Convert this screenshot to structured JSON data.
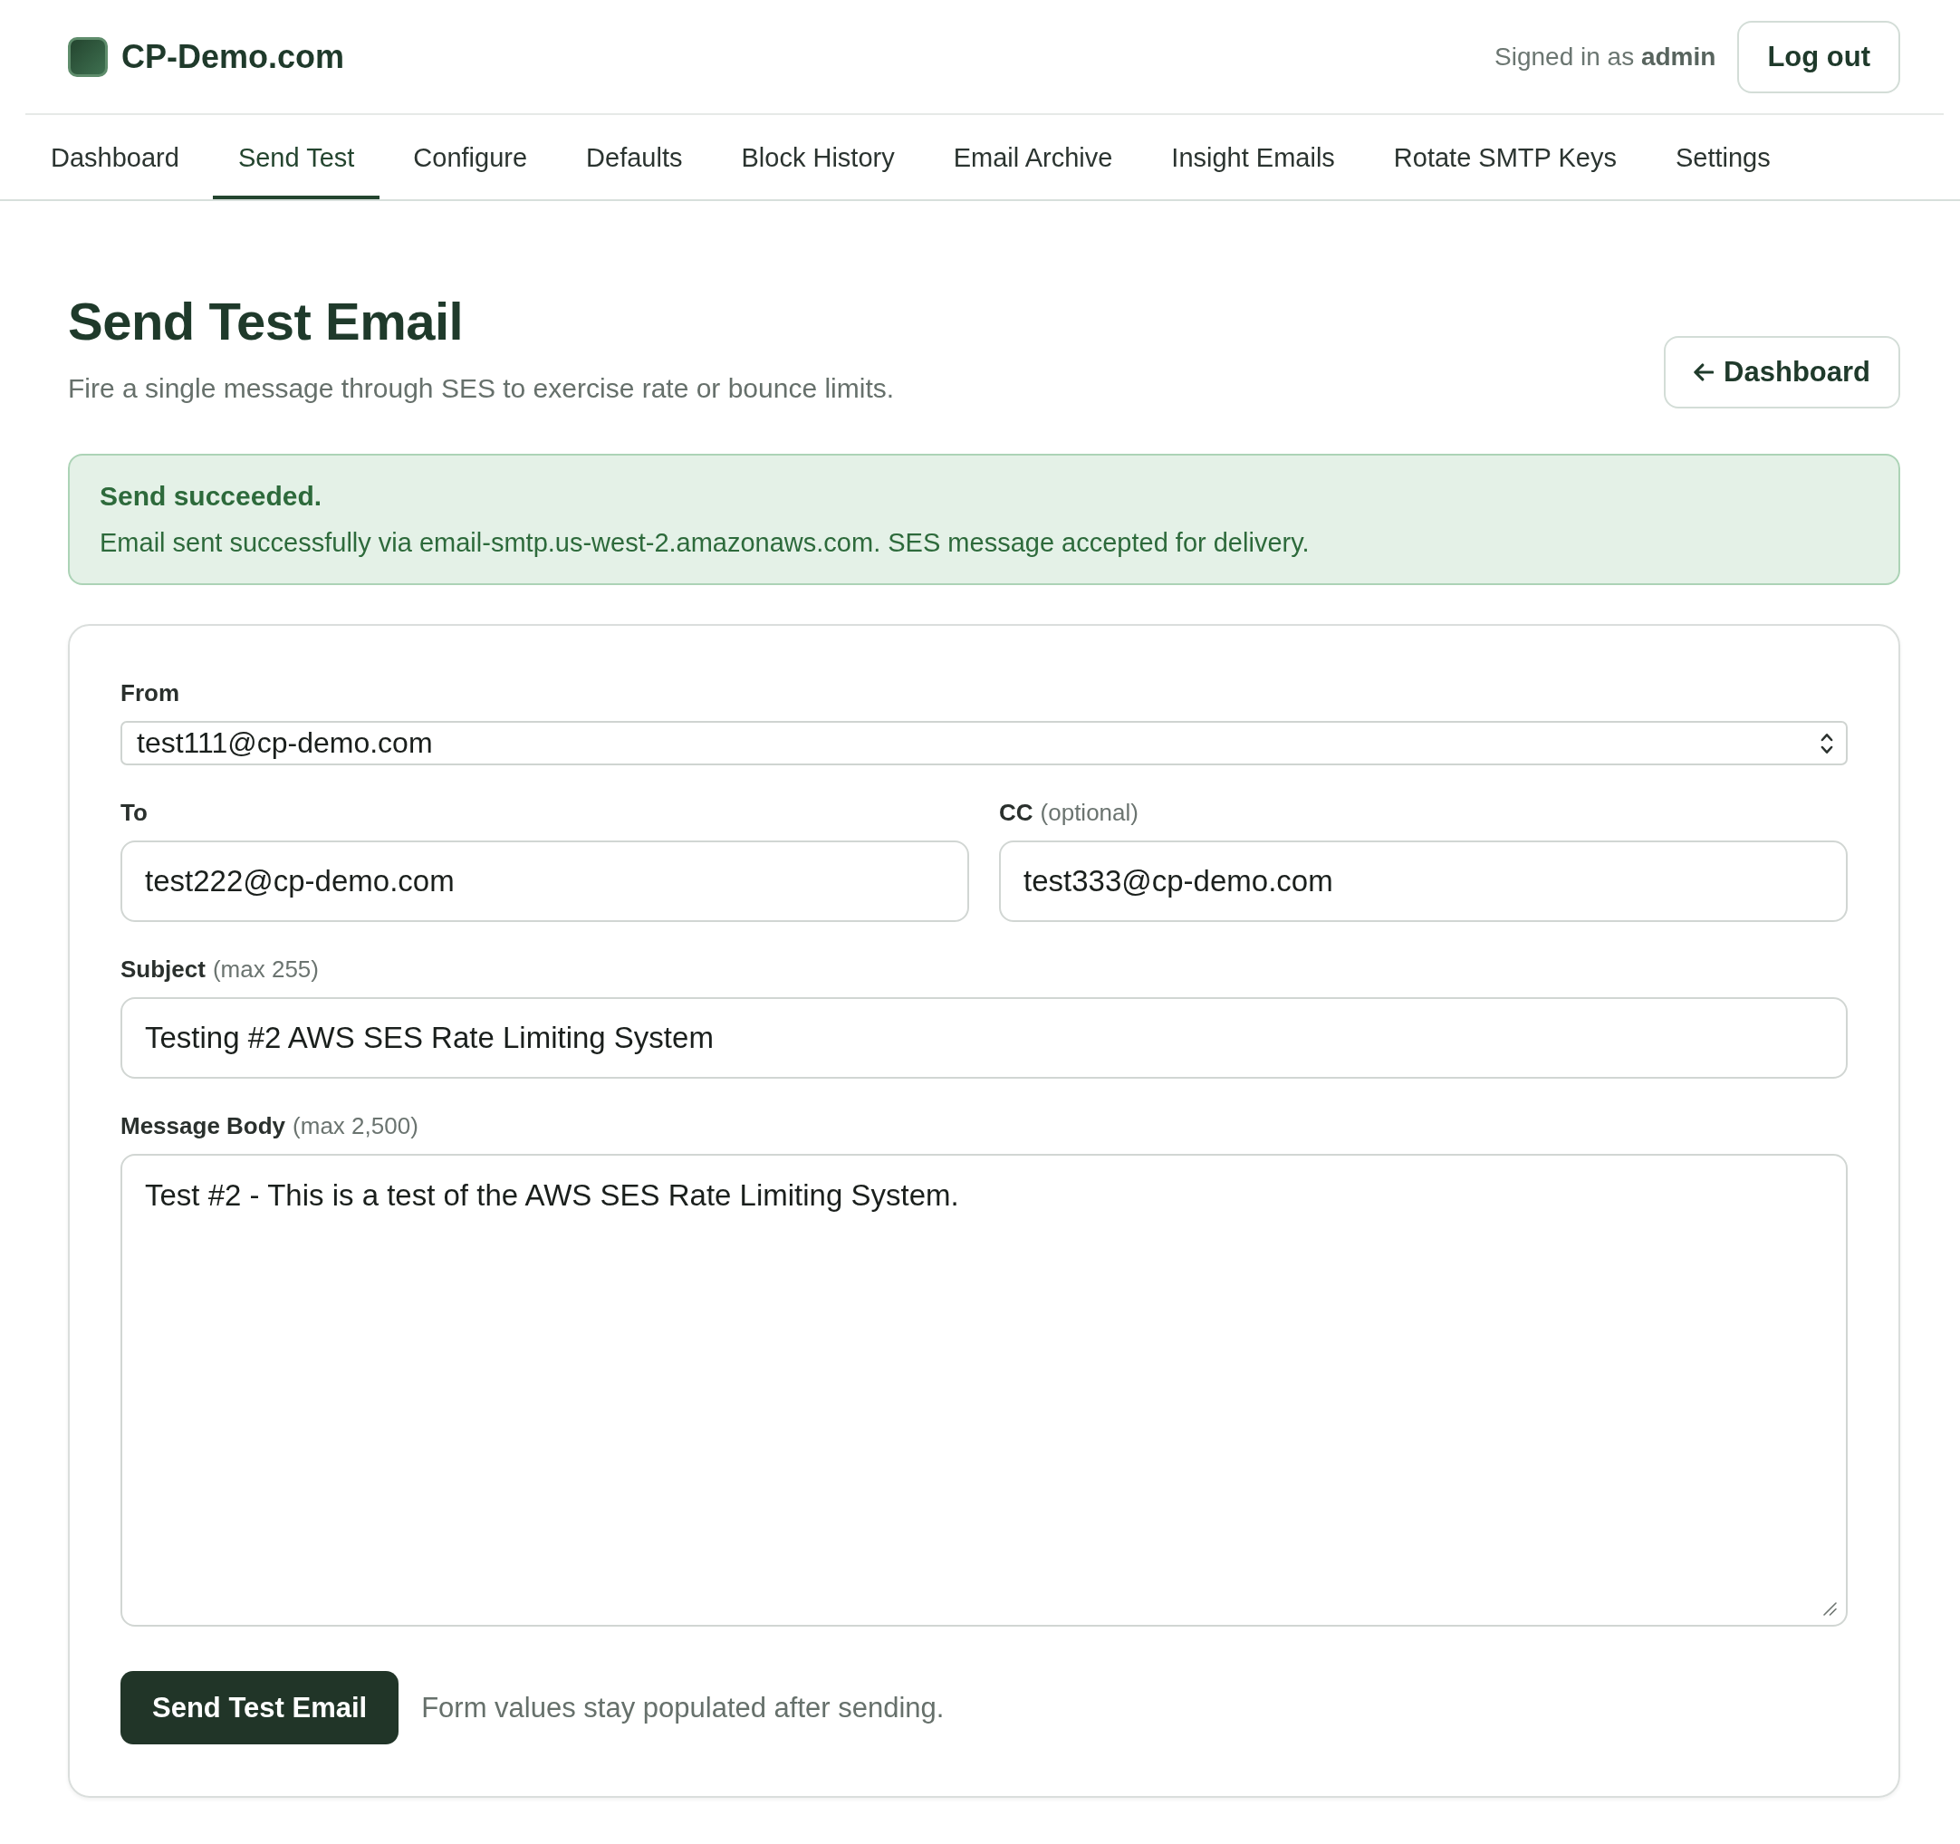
{
  "header": {
    "brand": "CP-Demo.com",
    "signed_in": "Signed in as **admin**",
    "logout_button": "Log out"
  },
  "nav": {
    "tabs": [
      {
        "label": "Dashboard",
        "selected": false
      },
      {
        "label": "Send Test",
        "selected": true
      },
      {
        "label": "Configure",
        "selected": false
      },
      {
        "label": "Defaults",
        "selected": false
      },
      {
        "label": "Block History",
        "selected": false
      },
      {
        "label": "Email Archive",
        "selected": false
      },
      {
        "label": "Insight Emails",
        "selected": false
      },
      {
        "label": "Rotate SMTP Keys",
        "selected": false
      },
      {
        "label": "Settings",
        "selected": false
      }
    ]
  },
  "page": {
    "title": "Send Test Email",
    "subtitle": "Fire a single message through SES to exercise rate or bounce limits.",
    "back_button": "Dashboard"
  },
  "alert": {
    "kind": "success",
    "title": "Send succeeded.",
    "message": "Email sent successfully via email-smtp.us-west-2.amazonaws.com. SES message accepted for delivery."
  },
  "form": {
    "rows": [
      {
        "fields": [
          {
            "kind": "select",
            "label": "From",
            "value": "test111@cp-demo.com"
          }
        ]
      },
      {
        "fields": [
          {
            "kind": "text",
            "label": "To",
            "value": "test222@cp-demo.com"
          },
          {
            "kind": "text",
            "label": "CC",
            "hint": "(optional)",
            "value": "test333@cp-demo.com"
          }
        ]
      },
      {
        "fields": [
          {
            "kind": "text",
            "label": "Subject",
            "hint": "(max 255)",
            "value": "Testing #2 AWS SES Rate Limiting System"
          }
        ]
      },
      {
        "fields": [
          {
            "kind": "textarea",
            "label": "Message Body",
            "hint": "(max 2,500)",
            "value": "Test #2 - This is a test of the AWS SES Rate Limiting System."
          }
        ]
      }
    ],
    "submit_button": "Send Test Email",
    "note": "Form values stay populated after sending."
  }
}
